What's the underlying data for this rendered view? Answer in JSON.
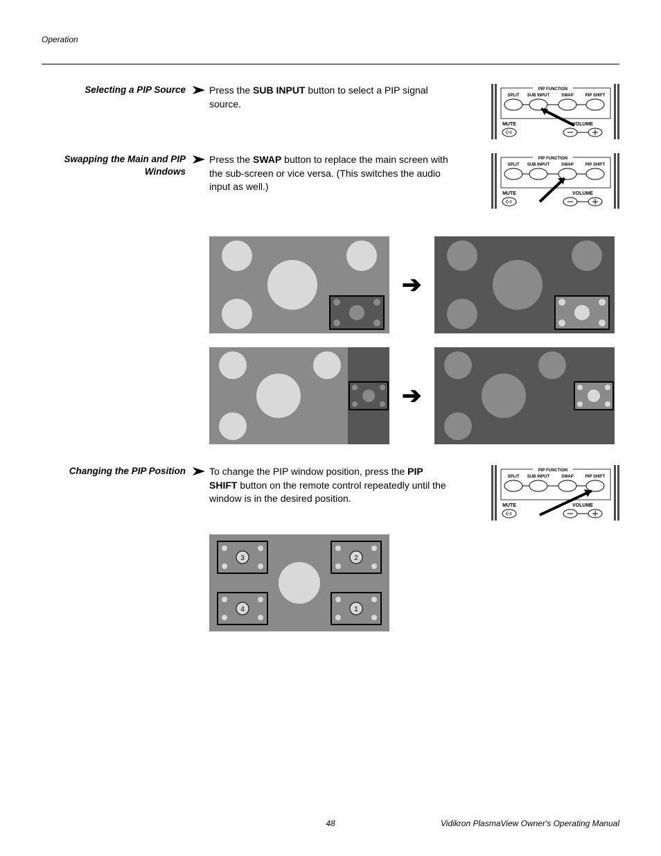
{
  "header": {
    "section": "Operation"
  },
  "rows": {
    "r1": {
      "heading": "Selecting a PIP Source",
      "body_pre": "Press the ",
      "body_bold": "SUB INPUT",
      "body_post": " button to select a PIP signal source."
    },
    "r2": {
      "heading": "Swapping the Main and PIP Windows",
      "body_pre": "Press the ",
      "body_bold": "SWAP",
      "body_post": " button to replace the main screen with the sub-screen or vice versa. (This switches the audio input as well.)"
    },
    "r3": {
      "heading": "Changing the PIP Position",
      "body_pre": "To change the PIP window position, press the ",
      "body_bold": "PIP SHIFT",
      "body_post": " button on the remote control repeatedly until the window is in the desired position."
    }
  },
  "remote": {
    "group_title": "PIP FUNCTION",
    "btn_split": "SPLIT",
    "btn_sub": "SUB INPUT",
    "btn_swap": "SWAP",
    "btn_shift": "PIP SHIFT",
    "lbl_mute": "MUTE",
    "lbl_vol": "VOLUME"
  },
  "pip_positions": {
    "p1": "1",
    "p2": "2",
    "p3": "3",
    "p4": "4"
  },
  "footer": {
    "page": "48",
    "title": "Vidikron PlasmaView Owner's Operating Manual"
  }
}
